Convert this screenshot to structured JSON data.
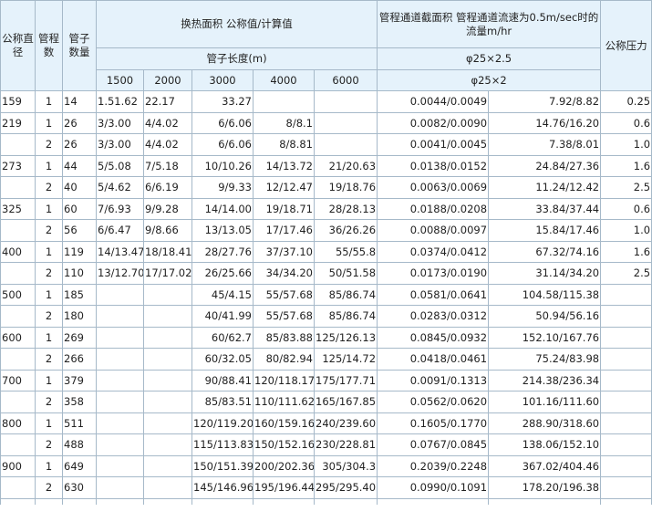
{
  "header": {
    "nominal_diameter": "公称直径",
    "tube_passes": "管程数",
    "tube_count": "管子数量",
    "heat_area": "换热面积 公称值/计算值",
    "flow_header": "管程通道截面积 管程通道流速为0.5m/sec时的流量m/hr",
    "nominal_pressure": "公称压力",
    "tube_length": "管子长度(m)",
    "lengths": [
      "1500",
      "2000",
      "3000",
      "4000",
      "6000"
    ],
    "phi1": "φ25×2.5",
    "phi2": "φ25×2"
  },
  "rows": [
    {
      "dn": "159",
      "pass": "1",
      "num": "14",
      "a1500": "1.51.62",
      "a2000": "22.17",
      "a3000": "33.27",
      "a4000": "",
      "a6000": "",
      "area": "0.0044/0.0049",
      "flow": "7.92/8.82",
      "pn": "0.25"
    },
    {
      "dn": "219",
      "pass": "1",
      "num": "26",
      "a1500": "3/3.00",
      "a2000": "4/4.02",
      "a3000": "6/6.06",
      "a4000": "8/8.1",
      "a6000": "",
      "area": "0.0082/0.0090",
      "flow": "14.76/16.20",
      "pn": "0.6"
    },
    {
      "dn": "",
      "pass": "2",
      "num": "26",
      "a1500": "3/3.00",
      "a2000": "4/4.02",
      "a3000": "6/6.06",
      "a4000": "8/8.81",
      "a6000": "",
      "area": "0.0041/0.0045",
      "flow": "7.38/8.01",
      "pn": "1.0"
    },
    {
      "dn": "273",
      "pass": "1",
      "num": "44",
      "a1500": "5/5.08",
      "a2000": "7/5.18",
      "a3000": "10/10.26",
      "a4000": "14/13.72",
      "a6000": "21/20.63",
      "area": "0.0138/0.0152",
      "flow": "24.84/27.36",
      "pn": "1.6"
    },
    {
      "dn": "",
      "pass": "2",
      "num": "40",
      "a1500": "5/4.62",
      "a2000": "6/6.19",
      "a3000": "9/9.33",
      "a4000": "12/12.47",
      "a6000": "19/18.76",
      "area": "0.0063/0.0069",
      "flow": "11.24/12.42",
      "pn": "2.5"
    },
    {
      "dn": "325",
      "pass": "1",
      "num": "60",
      "a1500": "7/6.93",
      "a2000": "9/9.28",
      "a3000": "14/14.00",
      "a4000": "19/18.71",
      "a6000": "28/28.13",
      "area": "0.0188/0.0208",
      "flow": "33.84/37.44",
      "pn": "0.6"
    },
    {
      "dn": "",
      "pass": "2",
      "num": "56",
      "a1500": "6/6.47",
      "a2000": "9/8.66",
      "a3000": "13/13.05",
      "a4000": "17/17.46",
      "a6000": "36/26.26",
      "area": "0.0088/0.0097",
      "flow": "15.84/17.46",
      "pn": "1.0"
    },
    {
      "dn": "400",
      "pass": "1",
      "num": "119",
      "a1500": "14/13.47",
      "a2000": "18/18.41",
      "a3000": "28/27.76",
      "a4000": "37/37.10",
      "a6000": "55/55.8",
      "area": "0.0374/0.0412",
      "flow": "67.32/74.16",
      "pn": "1.6"
    },
    {
      "dn": "",
      "pass": "2",
      "num": "110",
      "a1500": "13/12.70",
      "a2000": "17/17.02",
      "a3000": "26/25.66",
      "a4000": "34/34.20",
      "a6000": "50/51.58",
      "area": "0.0173/0.0190",
      "flow": "31.14/34.20",
      "pn": "2.5"
    },
    {
      "dn": "500",
      "pass": "1",
      "num": "185",
      "a1500": "",
      "a2000": "",
      "a3000": "45/4.15",
      "a4000": "55/57.68",
      "a6000": "85/86.74",
      "area": "0.0581/0.0641",
      "flow": "104.58/115.38",
      "pn": ""
    },
    {
      "dn": "",
      "pass": "2",
      "num": "180",
      "a1500": "",
      "a2000": "",
      "a3000": "40/41.99",
      "a4000": "55/57.68",
      "a6000": "85/86.74",
      "area": "0.0283/0.0312",
      "flow": "50.94/56.16",
      "pn": ""
    },
    {
      "dn": "600",
      "pass": "1",
      "num": "269",
      "a1500": "",
      "a2000": "",
      "a3000": "60/62.7",
      "a4000": "85/83.88",
      "a6000": "125/126.13",
      "area": "0.0845/0.0932",
      "flow": "152.10/167.76",
      "pn": ""
    },
    {
      "dn": "",
      "pass": "2",
      "num": "266",
      "a1500": "",
      "a2000": "",
      "a3000": "60/32.05",
      "a4000": "80/82.94",
      "a6000": "125/14.72",
      "area": "0.0418/0.0461",
      "flow": "75.24/83.98",
      "pn": ""
    },
    {
      "dn": "700",
      "pass": "1",
      "num": "379",
      "a1500": "",
      "a2000": "",
      "a3000": "90/88.41",
      "a4000": "120/118.17",
      "a6000": "175/177.71",
      "area": "0.0091/0.1313",
      "flow": "214.38/236.34",
      "pn": ""
    },
    {
      "dn": "",
      "pass": "2",
      "num": "358",
      "a1500": "",
      "a2000": "",
      "a3000": "85/83.51",
      "a4000": "110/111.62",
      "a6000": "165/167.85",
      "area": "0.0562/0.0620",
      "flow": "101.16/111.60",
      "pn": ""
    },
    {
      "dn": "800",
      "pass": "1",
      "num": "511",
      "a1500": "",
      "a2000": "",
      "a3000": "120/119.20",
      "a4000": "160/159.16",
      "a6000": "240/239.60",
      "area": "0.1605/0.1770",
      "flow": "288.90/318.60",
      "pn": ""
    },
    {
      "dn": "",
      "pass": "2",
      "num": "488",
      "a1500": "",
      "a2000": "",
      "a3000": "115/113.83",
      "a4000": "150/152.16",
      "a6000": "230/228.81",
      "area": "0.0767/0.0845",
      "flow": "138.06/152.10",
      "pn": ""
    },
    {
      "dn": "900",
      "pass": "1",
      "num": "649",
      "a1500": "",
      "a2000": "",
      "a3000": "150/151.39",
      "a4000": "200/202.36",
      "a6000": "305/304.3",
      "area": "0.2039/0.2248",
      "flow": "367.02/404.46",
      "pn": ""
    },
    {
      "dn": "",
      "pass": "2",
      "num": "630",
      "a1500": "",
      "a2000": "",
      "a3000": "145/146.96",
      "a4000": "195/196.44",
      "a6000": "295/295.40",
      "area": "0.0990/0.1091",
      "flow": "178.20/196.38",
      "pn": ""
    }
  ]
}
